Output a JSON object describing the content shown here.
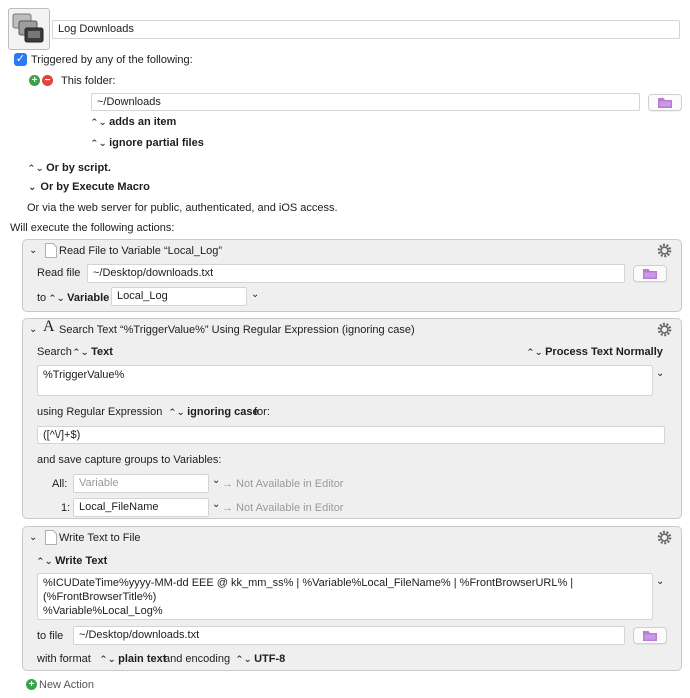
{
  "macro": {
    "name": "Log Downloads"
  },
  "trigger": {
    "triggered_label": "Triggered by any of the following:",
    "this_folder": "This folder:",
    "folder_path": "~/Downloads",
    "adds": "adds an item",
    "partial": "ignore partial files",
    "by_script": "Or by script.",
    "by_execute": "Or by Execute Macro",
    "web_server": "Or via the web server for public, authenticated, and iOS access."
  },
  "will_execute": "Will execute the following actions:",
  "action1": {
    "title": "Read File to Variable “Local_Log”",
    "read_file_label": "Read file",
    "file_path": "~/Desktop/downloads.txt",
    "to_label": "to",
    "variable_selector": "Variable",
    "variable_name": "Local_Log"
  },
  "action2": {
    "title": "Search Text “%TriggerValue%” Using Regular Expression (ignoring case)",
    "search_label": "Search",
    "text_selector": "Text",
    "process_selector": "Process Text Normally",
    "search_text": "%TriggerValue%",
    "using_label": "using Regular Expression",
    "case_selector": "ignoring case",
    "for_label": "for:",
    "regex": "([^\\/]+$)",
    "save_label": "and save capture groups to Variables:",
    "all_label": "All:",
    "all_placeholder": "Variable",
    "not_available_1": "→ Not Available in Editor",
    "one_label": "1:",
    "one_value": "Local_FileName",
    "not_available_2": "→ Not Available in Editor"
  },
  "action3": {
    "title": "Write Text to File",
    "write_selector": "Write Text",
    "text_line1": "%ICUDateTime%yyyy-MM-dd EEE @ kk_mm_ss% | %Variable%Local_FileName% | %FrontBrowserURL% |",
    "text_line2": "(%FrontBrowserTitle%)",
    "text_line3": "%Variable%Local_Log%",
    "to_file_label": "to file",
    "file_path": "~/Desktop/downloads.txt",
    "format_label": "with format",
    "format_selector": "plain text",
    "encoding_label": "and encoding",
    "encoding_selector": "UTF-8"
  },
  "new_action": "New Action",
  "colors": {
    "accent": "#2a7cf6",
    "add": "#3aa34a",
    "remove": "#e0443e",
    "folder": "#b77bd9"
  }
}
